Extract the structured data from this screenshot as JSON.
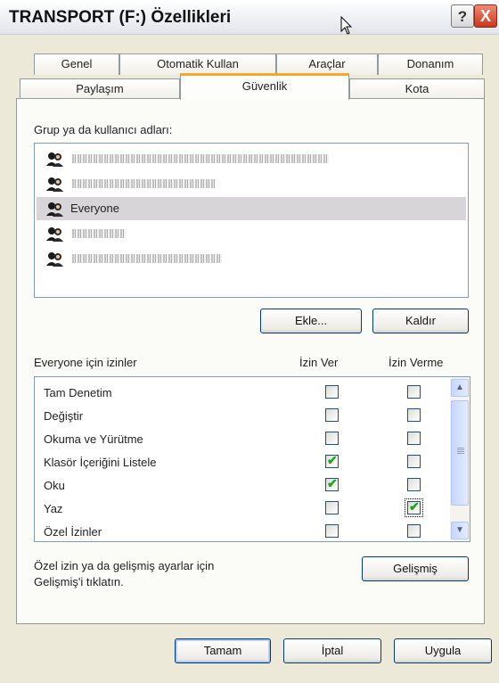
{
  "window": {
    "title": "TRANSPORT (F:) Özellikleri",
    "help_label": "?",
    "close_label": "X"
  },
  "tabs_top": [
    "Genel",
    "Otomatik Kullan",
    "Araçlar",
    "Donanım"
  ],
  "tabs_bottom": [
    "Paylaşım",
    "Güvenlik",
    "Kota"
  ],
  "active_tab": "Güvenlik",
  "security": {
    "users_label": "Grup ya da kullanıcı adları:",
    "users": [
      {
        "name": "",
        "redacted": true
      },
      {
        "name": "",
        "redacted": true
      },
      {
        "name": "Everyone",
        "redacted": false,
        "selected": true
      },
      {
        "name": "",
        "redacted": true
      },
      {
        "name": "",
        "redacted": true
      }
    ],
    "add_button": "Ekle...",
    "remove_button": "Kaldır",
    "permissions_label": "Everyone için izinler",
    "allow_header": "İzin Ver",
    "deny_header": "İzin Verme",
    "permissions": [
      {
        "name": "Tam Denetim",
        "allow": false,
        "deny": false
      },
      {
        "name": "Değiştir",
        "allow": false,
        "deny": false
      },
      {
        "name": "Okuma ve Yürütme",
        "allow": false,
        "deny": false
      },
      {
        "name": "Klasör İçeriğini Listele",
        "allow": true,
        "deny": false
      },
      {
        "name": "Oku",
        "allow": true,
        "deny": false
      },
      {
        "name": "Yaz",
        "allow": false,
        "deny": true
      },
      {
        "name": "Özel İzinler",
        "allow": false,
        "deny": false
      }
    ],
    "advanced_hint": "Özel izin ya da gelişmiş ayarlar için Gelişmiş'i tıklatın.",
    "advanced_button": "Gelişmiş"
  },
  "buttons": {
    "ok": "Tamam",
    "cancel": "İptal",
    "apply": "Uygula"
  },
  "colors": {
    "dialog_bg": "#ece9d8",
    "active_tab_accent": "#f6a828",
    "check_green": "#21a121"
  }
}
